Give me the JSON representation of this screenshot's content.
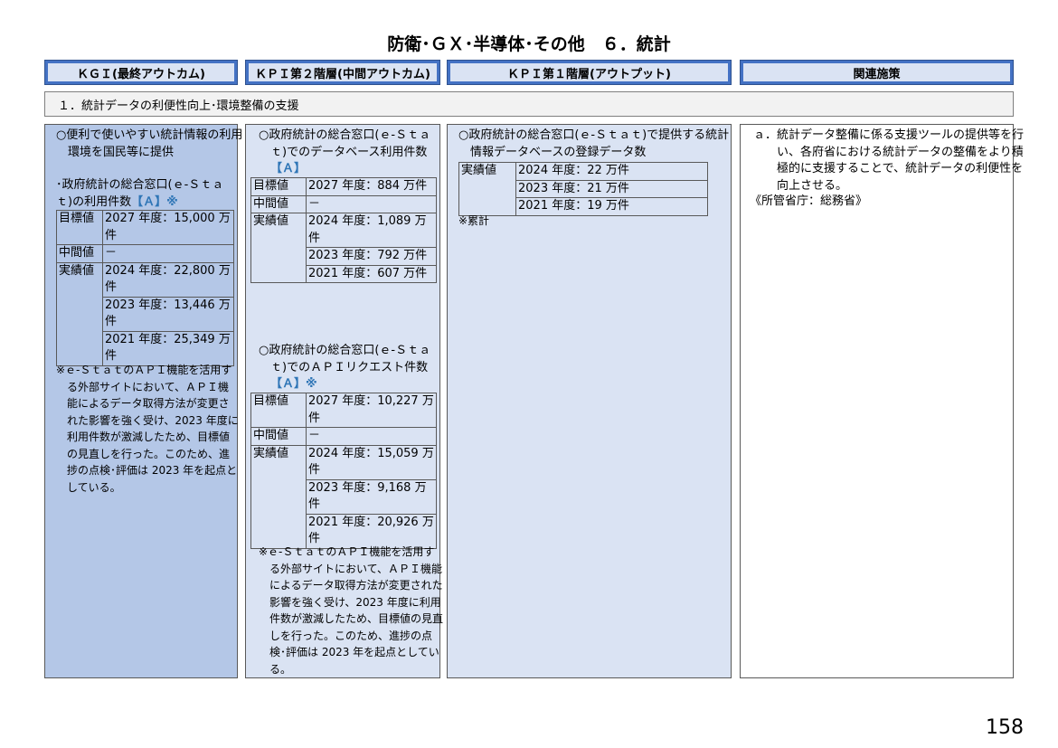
{
  "title": "防衛･ＧＸ･半導体･その他　６．統計",
  "headers": {
    "kgi": "ＫＧＩ(最終アウトカム)",
    "kpi2": "ＫＰＩ第２階層(中間アウトカム)",
    "kpi1": "ＫＰＩ第１階層(アウトプット)",
    "measures": "関連施策"
  },
  "section_label": "１．統計データの利便性向上･環境整備の支援",
  "kgi": {
    "goal": "○便利で使いやすい統計情報の利用環境を国民等に提供",
    "indicator_pre": "･政府統計の総合窓口(ｅ-Ｓｔａｔ)の利用件数",
    "indicator_open": "【",
    "rating": "Ａ",
    "indicator_close": "】※",
    "labels": {
      "target": "目標値",
      "mid": "中間値",
      "actual": "実績値"
    },
    "target": "2027 年度：15,000 万件",
    "mid": "－",
    "actuals": [
      "2024 年度：22,800 万件",
      "2023 年度：13,446 万件",
      "2021 年度：25,349 万件"
    ],
    "note": "※ｅ-ＳｔａｔのＡＰＩ機能を活用する外部サイトにおいて、ＡＰＩ機能によるデータ取得方法が変更された影響を強く受け、2023 年度に利用件数が激減したため、目標値の見直しを行った。このため、進捗の点検･評価は 2023 年を起点としている。"
  },
  "kpi2": {
    "item1": {
      "goal_pre": "○政府統計の総合窓口(ｅ-Ｓｔａｔ)でのデータベース利用件数",
      "open": "【",
      "rating": "Ａ",
      "close": "】",
      "target": "2027 年度：884 万件",
      "mid": "－",
      "actuals": [
        "2024 年度：1,089 万件",
        "2023 年度：792 万件",
        "2021 年度：607 万件"
      ]
    },
    "item2": {
      "goal_pre": "○政府統計の総合窓口(ｅ-Ｓｔａｔ)でのＡＰＩリクエスト件数",
      "open": "【",
      "rating": "Ａ",
      "close": "】※",
      "target": "2027 年度：10,227 万件",
      "mid": "－",
      "actuals": [
        "2024 年度：15,059 万件",
        "2023 年度：9,168 万件",
        "2021 年度：20,926 万件"
      ]
    },
    "note": "※ｅ-ＳｔａｔのＡＰＩ機能を活用する外部サイトにおいて、ＡＰＩ機能によるデータ取得方法が変更された影響を強く受け、2023 年度に利用件数が激減したため、目標値の見直しを行った。このため、進捗の点検･評価は 2023 年を起点としている。"
  },
  "kpi1": {
    "goal": "○政府統計の総合窓口(ｅ-Ｓｔａｔ)で提供する統計情報データベースの登録データ数",
    "actual_label": "実績値",
    "actuals": [
      "2024 年度：22 万件",
      "2023 年度：21 万件",
      "2021 年度：19 万件"
    ],
    "note": "※累計"
  },
  "measures": {
    "item": "ａ．統計データ整備に係る支援ツールの提供等を行い、各府省における統計データの整備をより積極的に支援することで、統計データの利便性を向上させる。",
    "ministry": "《所管省庁：総務省》"
  },
  "page_number": "158"
}
